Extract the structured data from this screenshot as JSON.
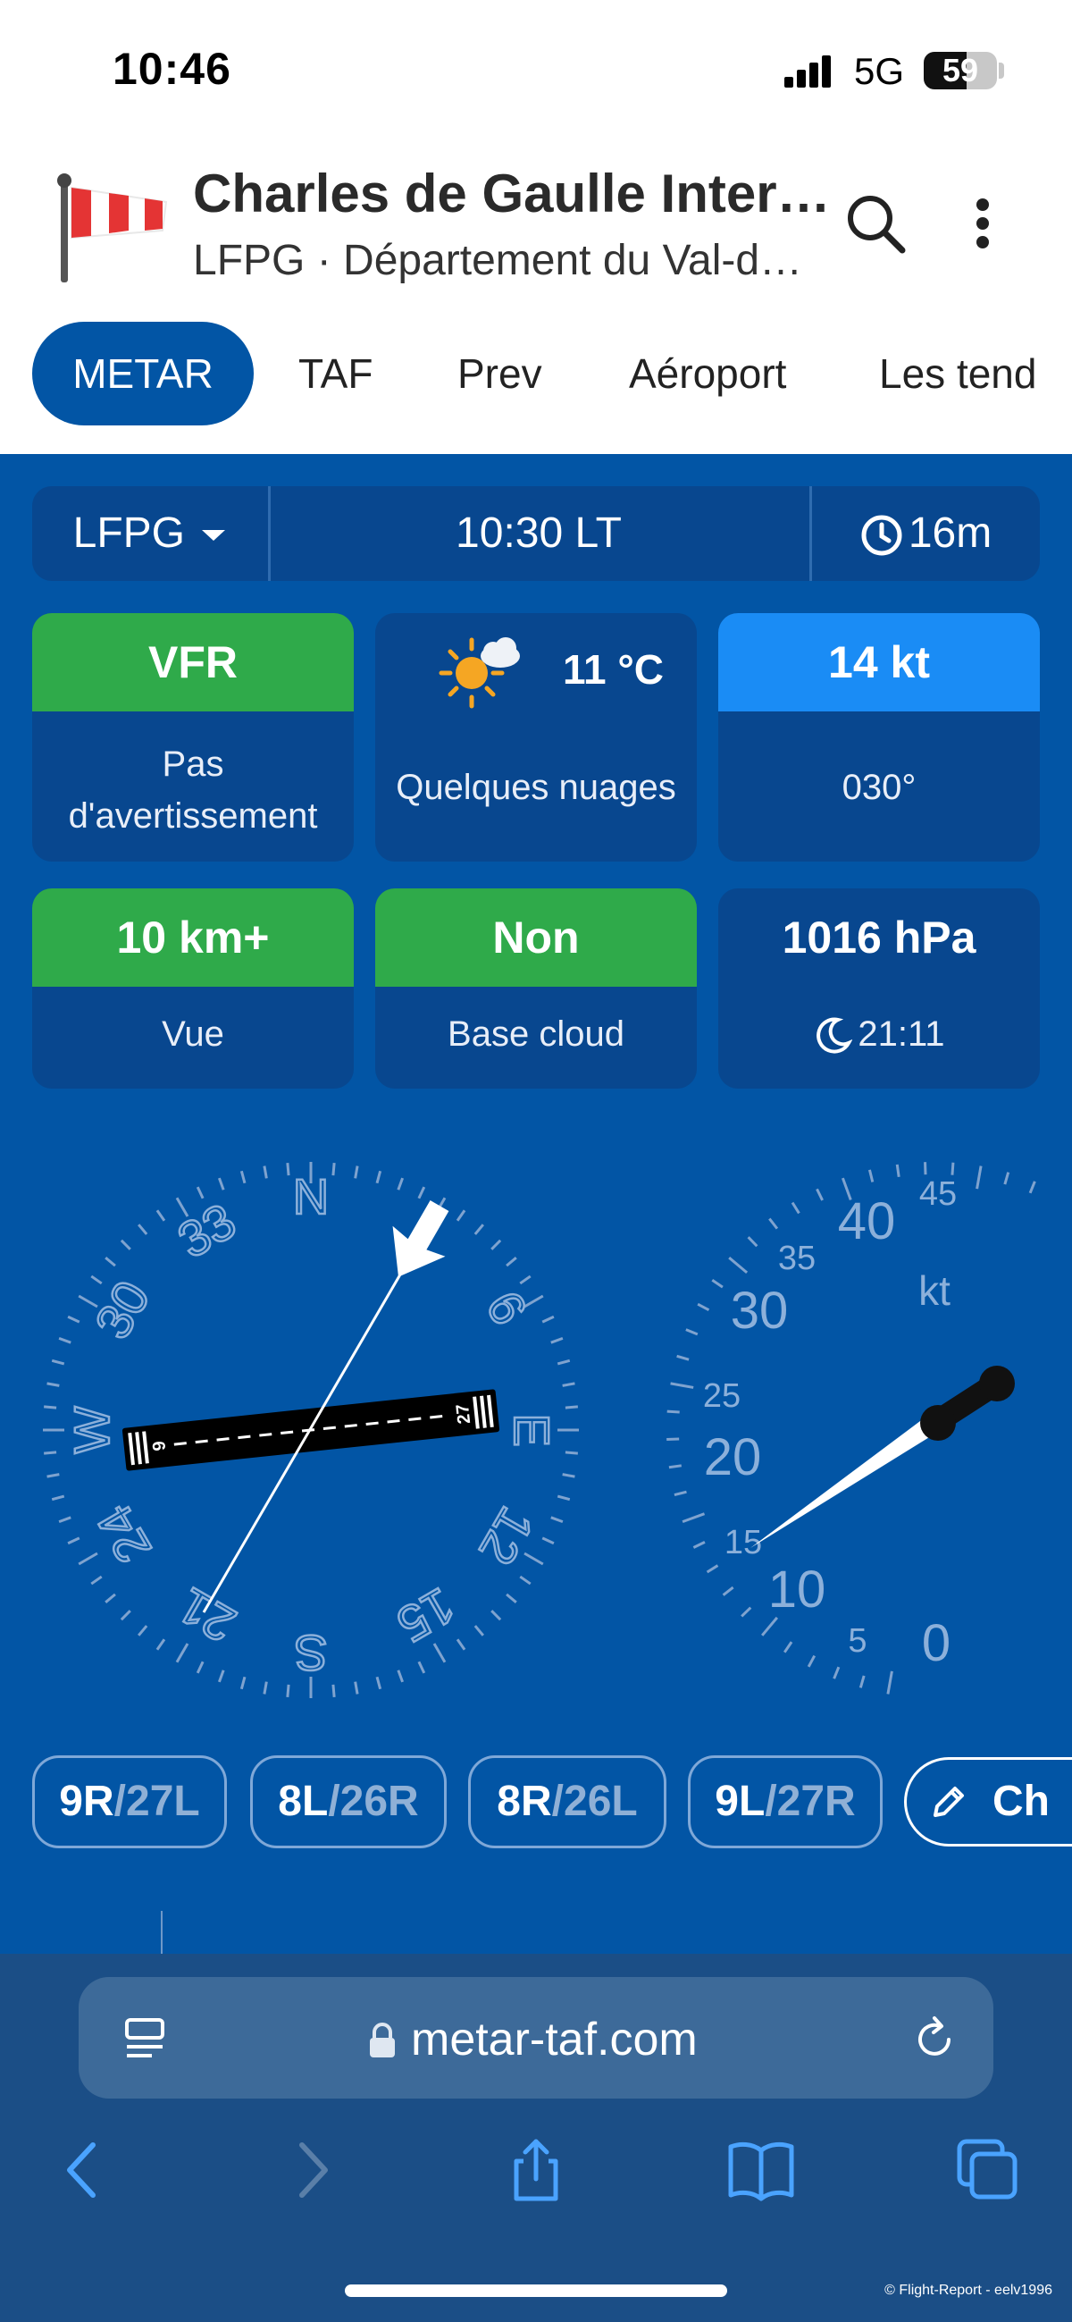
{
  "status_bar": {
    "time": "10:46",
    "network": "5G",
    "battery": "59",
    "battery_level": 0.59
  },
  "header": {
    "title": "Charles de Gaulle Inter…",
    "subtitle": "LFPG · Département du Val-d…",
    "logo_icon": "windsock-icon",
    "search_icon": "search-icon",
    "menu_icon": "more-vertical-icon"
  },
  "tabs": [
    "METAR",
    "TAF",
    "Prev",
    "Aéroport",
    "Les tend"
  ],
  "active_tab": "METAR",
  "info_bar": {
    "station": "LFPG",
    "report_time": "10:30 LT",
    "age": "16m",
    "clock_icon": "clock-icon",
    "caret_icon": "caret-down-icon"
  },
  "cards": [
    {
      "top": "VFR",
      "bottom_line1": "Pas",
      "bottom_line2": "d'avertissement",
      "color": "#2faa4a"
    },
    {
      "temperature": "11 °C",
      "bottom": "Quelques nuages",
      "icon": "partly-cloudy-sun-icon"
    },
    {
      "top": "14 kt",
      "bottom": "030°",
      "color": "#1a8cf5"
    },
    {
      "top": "10 km+",
      "bottom": "Vue",
      "color": "#2faa4a"
    },
    {
      "top": "Non",
      "bottom": "Base cloud",
      "color": "#2faa4a"
    },
    {
      "top": "1016 hPa",
      "bottom": "21:11",
      "icon": "moon-icon"
    }
  ],
  "compass": {
    "cardinals": [
      "N",
      "E",
      "S",
      "W"
    ],
    "numbers": [
      "33",
      "30",
      "6",
      "12",
      "15",
      "21",
      "24"
    ],
    "runway_labels": [
      "6",
      "27"
    ],
    "wind_direction_deg": 30
  },
  "wind_gauge": {
    "labels": [
      "0",
      "5",
      "10",
      "15",
      "20",
      "25",
      "30",
      "35",
      "40",
      "45"
    ],
    "unit": "kt",
    "value": 14
  },
  "runways": [
    {
      "primary": "9R",
      "secondary": "/27L"
    },
    {
      "primary": "8L",
      "secondary": "/26R"
    },
    {
      "primary": "8R",
      "secondary": "/26L"
    },
    {
      "primary": "9L",
      "secondary": "/27R"
    }
  ],
  "edit_chip": {
    "label": "Ch",
    "icon": "pencil-icon"
  },
  "browser": {
    "url": "metar-taf.com",
    "tabs_icon": "reader-icon",
    "lock_icon": "lock-icon",
    "reload_icon": "reload-icon",
    "nav_icons": [
      "back-icon",
      "forward-icon",
      "share-icon",
      "bookmarks-icon",
      "tabs-icon"
    ]
  },
  "watermark": "© Flight-Report - eelv1996"
}
